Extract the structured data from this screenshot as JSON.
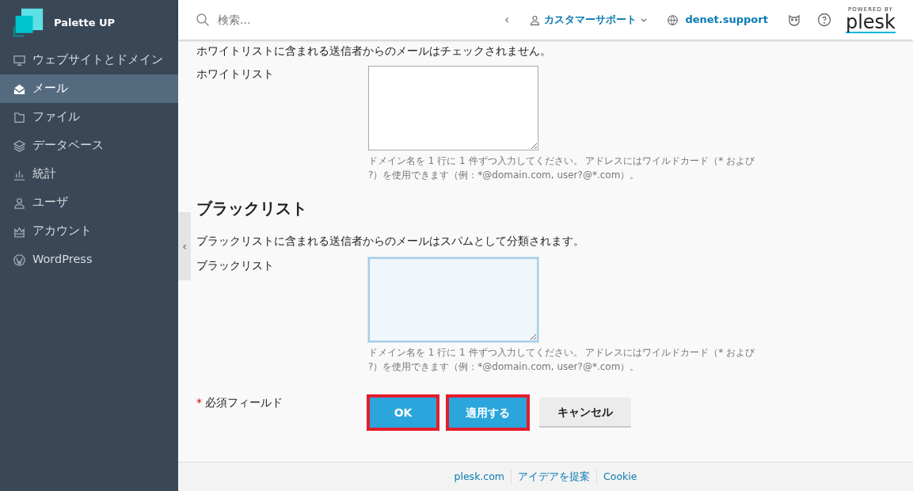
{
  "brand": {
    "name": "Palette UP"
  },
  "sidebar": {
    "items": [
      {
        "label": "ウェブサイトとドメイン",
        "selected": false
      },
      {
        "label": "メール",
        "selected": true
      },
      {
        "label": "ファイル",
        "selected": false
      },
      {
        "label": "データベース",
        "selected": false
      },
      {
        "label": "統計",
        "selected": false
      },
      {
        "label": "ユーザ",
        "selected": false
      },
      {
        "label": "アカウント",
        "selected": false
      },
      {
        "label": "WordPress",
        "selected": false
      }
    ],
    "collapse": "‹"
  },
  "header": {
    "search": {
      "placeholder": "検索..."
    },
    "back": "‹",
    "account": "カスタマーサポート",
    "domain": "denet.support",
    "powered_by": "POWERED BY",
    "logo": "plesk"
  },
  "form": {
    "whitelist_note": "ホワイトリストに含まれる送信者からのメールはチェックされません。",
    "whitelist": {
      "label": "ホワイトリスト",
      "focused": false,
      "hint": "ドメイン名を 1 行に 1 件ずつ入力してください。 アドレスにはワイルドカード（* および ?）を使用できます（例：*@domain.com, user?@*.com）。"
    },
    "blacklist_heading": "ブラックリスト",
    "blacklist_note": "ブラックリストに含まれる送信者からのメールはスパムとして分類されます。",
    "blacklist": {
      "label": "ブラックリスト",
      "focused": true,
      "hint": "ドメイン名を 1 行に 1 件ずつ入力してください。 アドレスにはワイルドカード（* および ?）を使用できます（例：*@domain.com, user?@*.com）。"
    },
    "required_mark": "*",
    "required_label": "必須フィールド",
    "buttons": [
      {
        "label": "OK",
        "kind": "primary",
        "highlighted": true
      },
      {
        "label": "適用する",
        "kind": "primary",
        "highlighted": true
      },
      {
        "label": "キャンセル",
        "kind": "secondary",
        "highlighted": false
      }
    ]
  },
  "footer": {
    "links": [
      "plesk.com",
      "アイデアを提案",
      "Cookie"
    ]
  }
}
